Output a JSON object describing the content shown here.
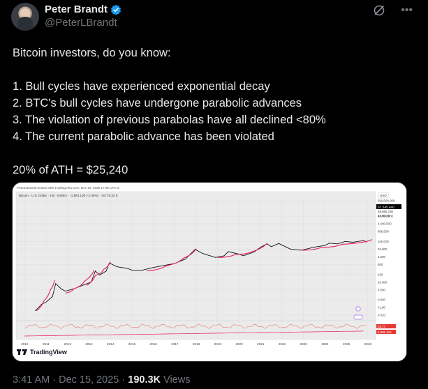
{
  "author": {
    "display_name": "Peter Brandt",
    "handle": "@PeterLBrandt"
  },
  "icons": {
    "verified": "verified-badge-icon",
    "grok": "grok-slash-icon",
    "more": "more-dots-icon",
    "tradingview": "tradingview-logo-icon"
  },
  "colors": {
    "verified": "#1d9bf0",
    "parabola": "#e91e63",
    "price_line": "#111111",
    "oscillator": "#e57373",
    "chart_bg": "#ececec"
  },
  "tweet": {
    "lines": [
      "Bitcoin investors, do you know:",
      "",
      "1. Bull cycles have experienced exponential decay",
      "2. BTC's bull cycles have undergone parabolic advances",
      "3. The violation of previous parabolas have all declined <80%",
      "4. The current parabolic advance has been violated",
      "",
      "20% of ATH = $25,240"
    ]
  },
  "chart": {
    "header": "PeterLBrandt created with TradingView.com, Dec 16, 2025 17:09 UTC-5",
    "symbol_line": "Bitcoin · U.S. Dollar · 1W · INDEX · -1,863.100 (-2.06%) · Vol 78.32 K",
    "currency": "USD",
    "price_badge": "87,545.440",
    "price_sub": "88,565.750",
    "time_badge": "21:50:49",
    "osc_badge_1": "25.77",
    "osc_badge_2": "9,006.415",
    "brand": "TradingView"
  },
  "chart_data": {
    "type": "line",
    "title": "Bitcoin · U.S. Dollar · 1W · INDEX",
    "yscale": "log",
    "y_tick_labels": [
      "500,000,000",
      "20,000,000",
      "4,000,000",
      "800,000",
      "100,000",
      "20,000",
      "4,000",
      "800",
      "100",
      "20.000",
      "4.000",
      "0.500",
      "0.100",
      "0.020"
    ],
    "x_tick_labels": [
      "2010",
      "2011",
      "2012",
      "2013",
      "2014",
      "2015",
      "2016",
      "2017",
      "2018",
      "2019",
      "2020",
      "2021",
      "2022",
      "2023",
      "2024",
      "2025",
      "2026"
    ],
    "series": [
      {
        "x": [
          2010.5,
          2010.8,
          2011.0,
          2011.3,
          2011.45,
          2011.7,
          2011.9,
          2012.3,
          2012.8,
          2013.1,
          2013.3,
          2013.5,
          2013.8,
          2013.95,
          2014.3,
          2014.8,
          2015.0,
          2015.5,
          2016.0,
          2016.5,
          2017.0,
          2017.5,
          2017.95,
          2018.3,
          2018.9,
          2019.3,
          2019.5,
          2020.0,
          2020.2,
          2020.7,
          2021.0,
          2021.3,
          2021.5,
          2021.85,
          2022.4,
          2022.9,
          2023.5,
          2024.0,
          2024.2,
          2024.6,
          2024.95,
          2025.3,
          2025.8,
          2025.95
        ],
        "y": [
          0.05,
          0.2,
          0.3,
          1,
          15,
          5,
          3,
          5,
          12,
          20,
          200,
          90,
          200,
          1100,
          500,
          350,
          250,
          250,
          430,
          650,
          1000,
          2500,
          19000,
          8000,
          3500,
          5000,
          12000,
          7000,
          5000,
          11000,
          30000,
          60000,
          33000,
          65000,
          20000,
          16000,
          30000,
          43000,
          70000,
          60000,
          100000,
          85000,
          120000,
          87545
        ]
      }
    ],
    "parabolas": [
      {
        "x": [
          2010.55,
          2010.9,
          2011.2,
          2011.4
        ],
        "y": [
          0.05,
          0.4,
          4,
          30
        ]
      },
      {
        "x": [
          2011.9,
          2012.3,
          2012.8,
          2013.25
        ],
        "y": [
          2,
          5,
          25,
          260
        ]
      },
      {
        "x": [
          2012.9,
          2013.3,
          2013.7,
          2014.0
        ],
        "y": [
          10,
          80,
          300,
          1400
        ]
      },
      {
        "x": [
          2015.7,
          2016.6,
          2017.4,
          2018.0
        ],
        "y": [
          210,
          600,
          3000,
          22000
        ]
      },
      {
        "x": [
          2019.0,
          2019.8,
          2020.6,
          2021.3
        ],
        "y": [
          3500,
          6500,
          12000,
          70000
        ]
      },
      {
        "x": [
          2022.9,
          2023.8,
          2024.8,
          2026.2
        ],
        "y": [
          16000,
          28000,
          55000,
          150000
        ]
      }
    ],
    "annotations": [
      "20% of ATH = $25,240"
    ]
  }
}
